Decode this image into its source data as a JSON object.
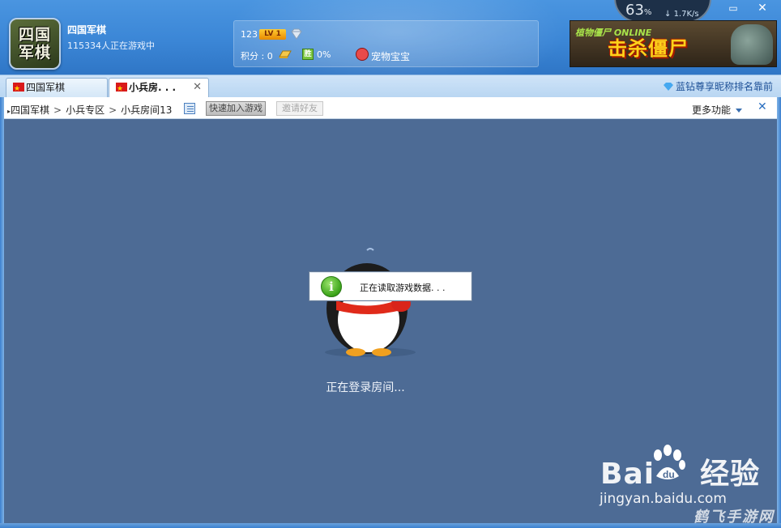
{
  "header": {
    "logo_text_line1": "四国",
    "logo_text_line2": "军棋",
    "game_title": "四国军棋",
    "online_count": "115334人正在游戏中",
    "user": {
      "id": "123",
      "level_badge": "LV 1",
      "score": "积分 : 0",
      "win_label": "胜",
      "win_rate": "0%",
      "pet_label": "宠物宝宝"
    },
    "gauge": {
      "value": "63",
      "unit": "%",
      "speed": "1.7",
      "speed_unit": "K/s"
    },
    "window_controls": {
      "minimize": "▭",
      "close": "✕"
    },
    "ad": {
      "small_text": "植物僵尸 ONLINE",
      "main_text": "击杀僵尸"
    }
  },
  "tabs": [
    {
      "label": "四国军棋",
      "active": false
    },
    {
      "label": "小兵房. . .",
      "active": true,
      "close": "✕"
    }
  ],
  "vip_link": "蓝钻尊享昵称排名靠前",
  "toolbar": {
    "breadcrumb": [
      "四国军棋",
      "小兵专区",
      "小兵房间13"
    ],
    "quick_join": "快速加入游戏",
    "invite": "邀请好友",
    "more_features": "更多功能",
    "close": "✕"
  },
  "content": {
    "loading_dialog_text": "正在读取游戏数据. . .",
    "room_status": "正在登录房间..."
  },
  "watermark": {
    "brand": "Bai",
    "brand_suffix": "经验",
    "url": "jingyan.baidu.com",
    "site": "鹤飞手游网"
  }
}
